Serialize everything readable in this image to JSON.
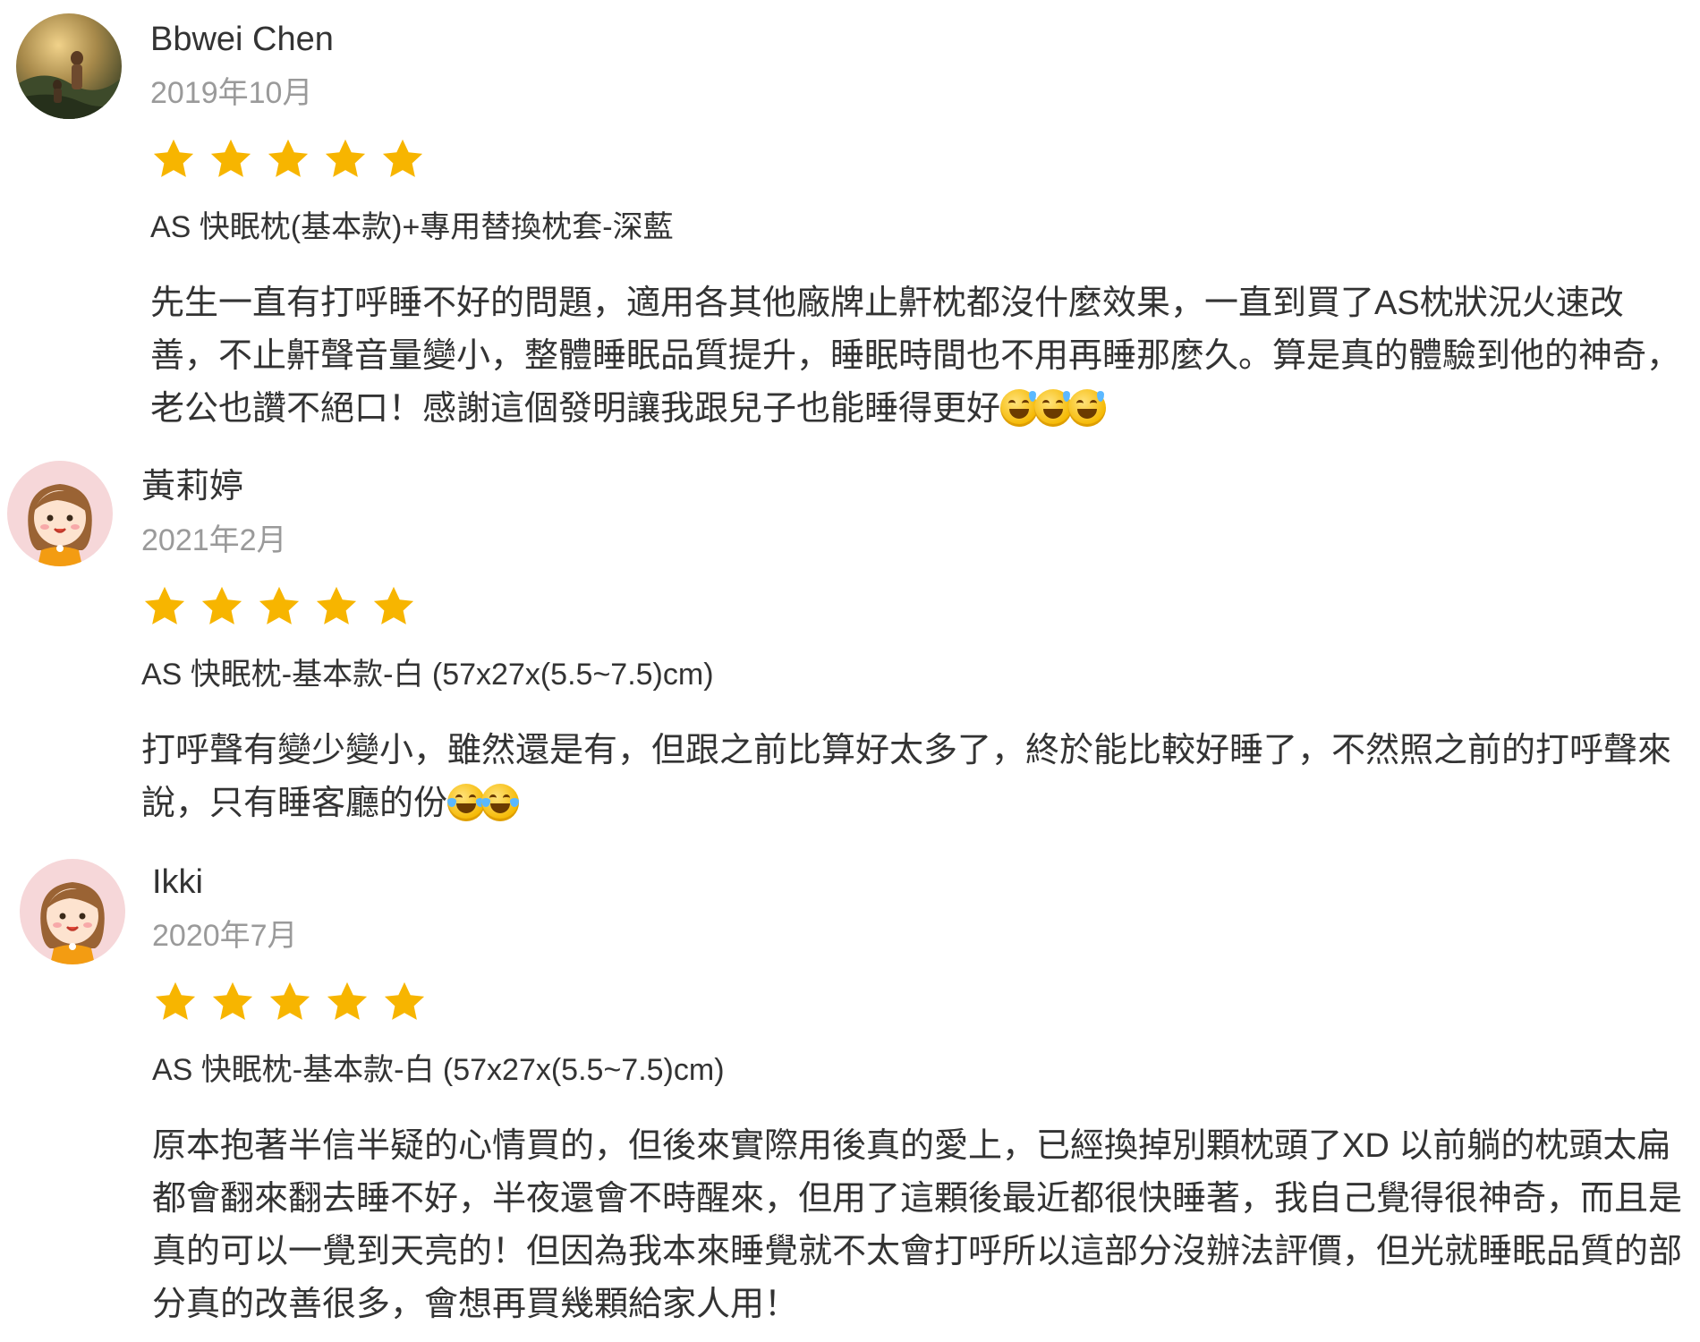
{
  "reviews": [
    {
      "name": "Bbwei Chen",
      "date": "2019年10月",
      "rating": 5,
      "product": "AS 快眠枕(基本款)+專用替換枕套-深藍",
      "text": "先生一直有打呼睡不好的問題，適用各其他廠牌止鼾枕都沒什麼效果，一直到買了AS枕狀況火速改善，不止鼾聲音量變小，整體睡眠品質提升，睡眠時間也不用再睡那麼久。算是真的體驗到他的神奇，老公也讚不絕口！感謝這個發明讓我跟兒子也能睡得更好",
      "emoji": [
        "grinning-sweat-emoji",
        "grinning-sweat-emoji",
        "grinning-sweat-emoji"
      ],
      "avatar": "photo-avatar"
    },
    {
      "name": "黃莉婷",
      "date": "2021年2月",
      "rating": 5,
      "product": "AS 快眠枕-基本款-白 (57x27x(5.5~7.5)cm)",
      "text": "打呼聲有變少變小，雖然還是有，但跟之前比算好太多了，終於能比較好睡了，不然照之前的打呼聲來說，只有睡客廳的份",
      "emoji": [
        "tears-of-joy-emoji",
        "tears-of-joy-emoji"
      ],
      "avatar": "default-girl-avatar"
    },
    {
      "name": "Ikki",
      "date": "2020年7月",
      "rating": 5,
      "product": "AS 快眠枕-基本款-白 (57x27x(5.5~7.5)cm)",
      "text": "原本抱著半信半疑的心情買的，但後來實際用後真的愛上，已經換掉別顆枕頭了XD 以前躺的枕頭太扁都會翻來翻去睡不好，半夜還會不時醒來，但用了這顆後最近都很快睡著，我自己覺得很神奇，而且是真的可以一覺到天亮的！但因為我本來睡覺就不太會打呼所以這部分沒辦法評價，但光就睡眠品質的部分真的改善很多，會想再買幾顆給家人用！",
      "emoji": [],
      "avatar": "default-girl-avatar"
    }
  ],
  "colors": {
    "star": "#f7b500",
    "name_text": "#333333",
    "date_text": "#9a9a9a",
    "avatar_bg": "#f6d7d9"
  }
}
